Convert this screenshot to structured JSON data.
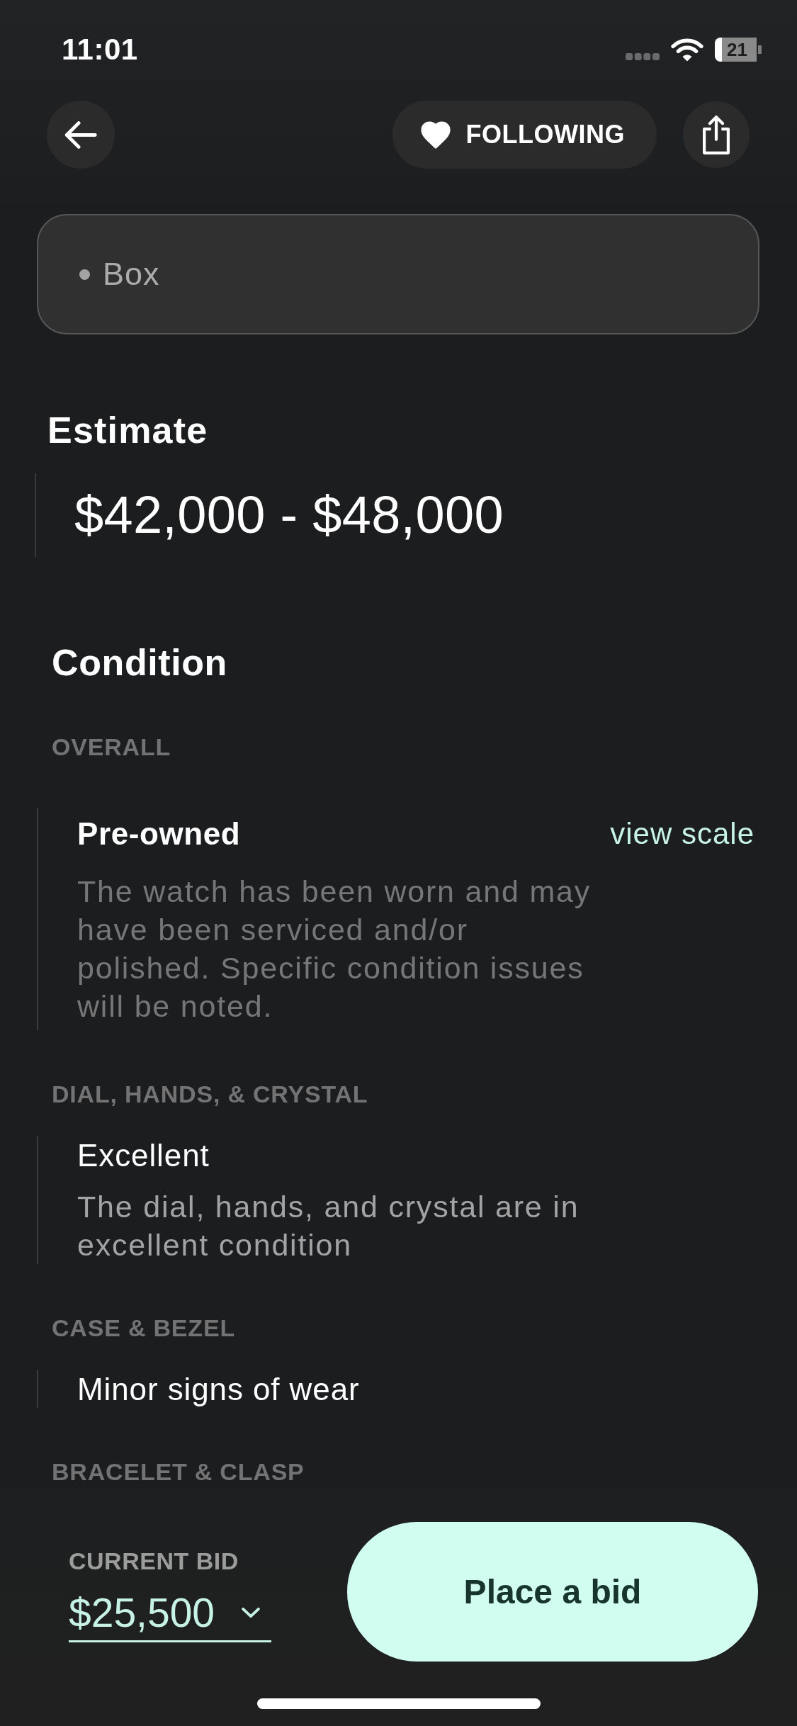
{
  "status_bar": {
    "time": "11:01",
    "battery": "21"
  },
  "header": {
    "follow_button": {
      "label": "FOLLOWING",
      "following": true
    }
  },
  "includes_card": {
    "items": [
      "Box"
    ]
  },
  "estimate": {
    "title": "Estimate",
    "value": "$42,000 - $48,000"
  },
  "condition": {
    "title": "Condition",
    "sections": [
      {
        "kind": "overall",
        "label": "OVERALL",
        "grade": "Pre-owned",
        "link": "view scale",
        "description": "The watch has been worn and may have been serviced and/or polished. Specific condition issues will be noted."
      },
      {
        "kind": "detail",
        "label": "DIAL, HANDS, & CRYSTAL",
        "grade": "Excellent",
        "description": "The dial, hands, and crystal are in excellent condition"
      },
      {
        "kind": "detail",
        "label": "CASE & BEZEL",
        "grade": "Minor signs of wear"
      },
      {
        "kind": "detail",
        "label": "BRACELET & CLASP"
      }
    ]
  },
  "bid_bar": {
    "label": "CURRENT BID",
    "amount": "$25,500",
    "button": "Place a bid"
  }
}
